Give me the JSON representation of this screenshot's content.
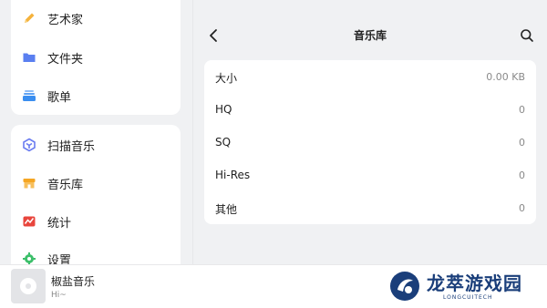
{
  "sidebar": {
    "top_items": [
      {
        "label": "艺术家",
        "icon": "pencil-icon",
        "color": "#f5b23c"
      },
      {
        "label": "文件夹",
        "icon": "folder-icon",
        "color": "#5a7ff0"
      },
      {
        "label": "歌单",
        "icon": "playlist-icon",
        "color": "#3a8ef0"
      }
    ],
    "bottom_items": [
      {
        "label": "扫描音乐",
        "icon": "scan-icon",
        "color": "#6a7cf0"
      },
      {
        "label": "音乐库",
        "icon": "library-icon",
        "color": "#f5a623"
      },
      {
        "label": "统计",
        "icon": "stats-icon",
        "color": "#e8453c"
      },
      {
        "label": "设置",
        "icon": "gear-icon",
        "color": "#3cbf6a"
      }
    ]
  },
  "header": {
    "title": "音乐库"
  },
  "stats": [
    {
      "label": "大小",
      "value": "0.00 KB"
    },
    {
      "label": "HQ",
      "value": "0"
    },
    {
      "label": "SQ",
      "value": "0"
    },
    {
      "label": "Hi-Res",
      "value": "0"
    },
    {
      "label": "其他",
      "value": "0"
    }
  ],
  "player": {
    "title": "椒盐音乐",
    "subtitle": "Hi~"
  },
  "watermark": {
    "text": "龙萃游戏园",
    "subtext": "LONGCUITECH"
  }
}
